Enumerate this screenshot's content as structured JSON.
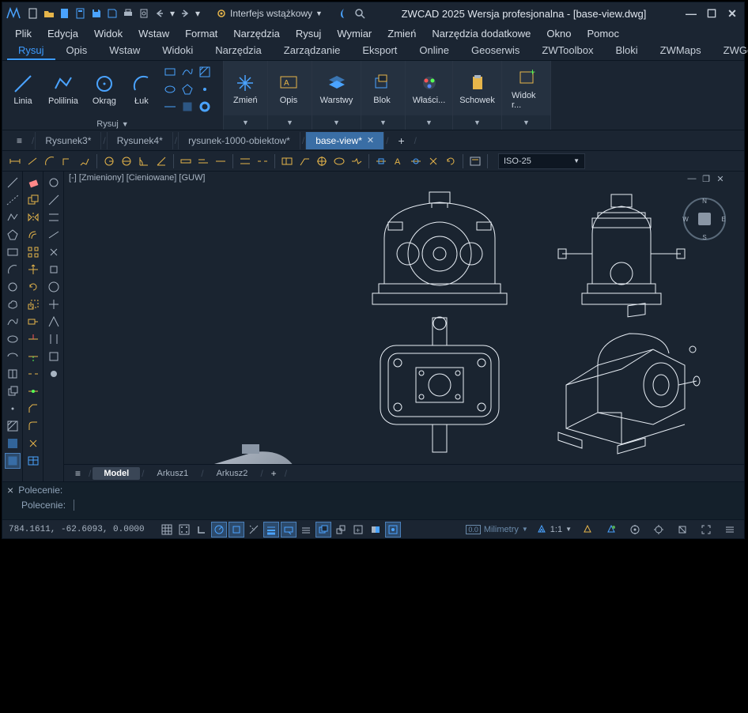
{
  "title": "ZWCAD 2025 Wersja profesjonalna - [base-view.dwg]",
  "interface_mode": "Interfejs wstążkowy",
  "menus": [
    "Plik",
    "Edycja",
    "Widok",
    "Wstaw",
    "Format",
    "Narzędzia",
    "Rysuj",
    "Wymiar",
    "Zmień",
    "Narzędzia dodatkowe",
    "Okno",
    "Pomoc"
  ],
  "ribbon_tabs": [
    "Rysuj",
    "Opis",
    "Wstaw",
    "Widoki",
    "Narzędzia",
    "Zarządzanie",
    "Eksport",
    "Online",
    "Geoserwis",
    "ZWToolbox",
    "Bloki",
    "ZWMaps",
    "ZWGeo"
  ],
  "ribbon_active": "Rysuj",
  "ribbon_panels": {
    "draw": {
      "label": "Rysuj",
      "items": [
        "Linia",
        "Polilinia",
        "Okrąg",
        "Łuk"
      ]
    },
    "modify": "Zmień",
    "annot": "Opis",
    "layers": "Warstwy",
    "block": "Blok",
    "props": "Właści...",
    "clipboard": "Schowek",
    "view": "Widok r..."
  },
  "doc_tabs": [
    "Rysunek3*",
    "Rysunek4*",
    "rysunek-1000-obiektow*",
    "base-view*"
  ],
  "doc_active": "base-view*",
  "dim_style": "ISO-25",
  "view_header": "[-] [Zmieniony] [Cieniowane] [GUW]",
  "layout_tabs": [
    "Model",
    "Arkusz1",
    "Arkusz2"
  ],
  "layout_active": "Model",
  "cmd_prompt": "Polecenie:",
  "coords": "784.1611, -62.6093, 0.0000",
  "status_units": "Milimetry",
  "status_scale": "1:1",
  "compass": {
    "n": "N",
    "e": "E",
    "s": "S",
    "w": "W"
  }
}
